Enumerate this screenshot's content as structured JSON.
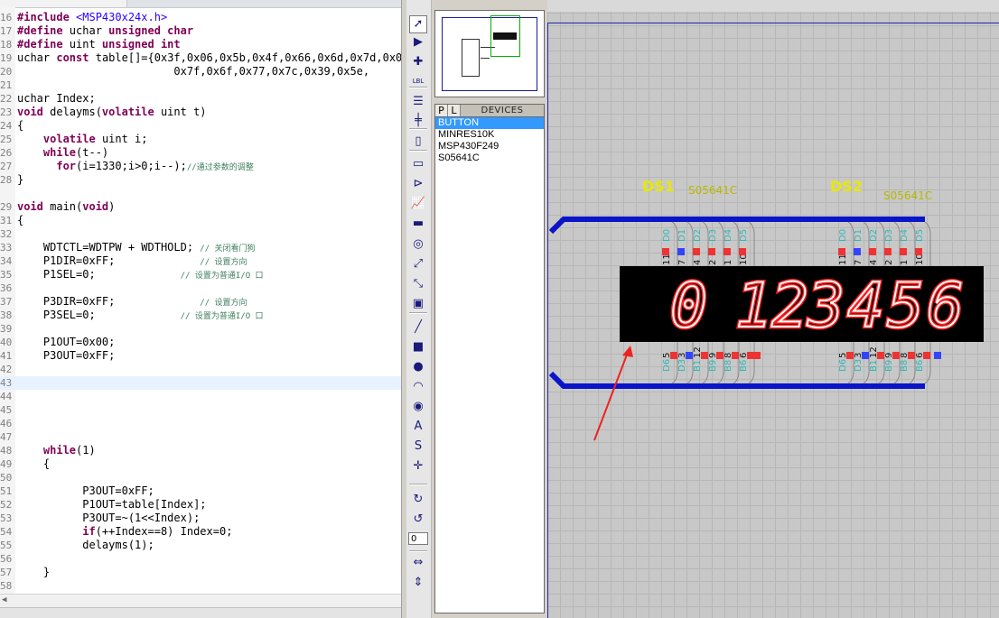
{
  "editor": {
    "lines": [
      {
        "n": "16",
        "parts": [
          [
            "pp",
            "#include "
          ],
          [
            "str",
            "<MSP430x24x.h>"
          ]
        ]
      },
      {
        "n": "17",
        "parts": [
          [
            "pp",
            "#define "
          ],
          [
            "",
            "uchar "
          ],
          [
            "kw",
            "unsigned char"
          ]
        ]
      },
      {
        "n": "18",
        "parts": [
          [
            "pp",
            "#define "
          ],
          [
            "",
            "uint "
          ],
          [
            "kw",
            "unsigned int"
          ]
        ]
      },
      {
        "n": "19",
        "parts": [
          [
            "",
            "uchar "
          ],
          [
            "kw",
            "const "
          ],
          [
            "",
            "table[]={0x3f,0x06,0x5b,0x4f,0x66,0x6d,0x7d,0x07,"
          ]
        ]
      },
      {
        "n": "20",
        "parts": [
          [
            "",
            "                        0x7f,0x6f,0x77,0x7c,0x39,0x5e,"
          ]
        ]
      },
      {
        "n": "21",
        "parts": []
      },
      {
        "n": "22",
        "parts": [
          [
            "",
            "uchar Index;"
          ]
        ]
      },
      {
        "n": "23",
        "parts": [
          [
            "kw",
            "void "
          ],
          [
            "",
            "delayms("
          ],
          [
            "kw",
            "volatile "
          ],
          [
            "",
            "uint t)"
          ]
        ]
      },
      {
        "n": "24",
        "parts": [
          [
            "",
            "{"
          ]
        ]
      },
      {
        "n": "25",
        "parts": [
          [
            "",
            "    "
          ],
          [
            "kw",
            "volatile "
          ],
          [
            "",
            "uint i;"
          ]
        ]
      },
      {
        "n": "26",
        "parts": [
          [
            "",
            "    "
          ],
          [
            "kw",
            "while"
          ],
          [
            "",
            "(t--)"
          ]
        ]
      },
      {
        "n": "27",
        "parts": [
          [
            "",
            "      "
          ],
          [
            "kw",
            "for"
          ],
          [
            "",
            "(i=1330;i>0;i--);"
          ],
          [
            "cm",
            "//通过参数的调整"
          ]
        ]
      },
      {
        "n": "28",
        "parts": [
          [
            "",
            "}"
          ]
        ]
      },
      {
        "n": "29",
        "parts": [
          [
            "kw",
            "void "
          ],
          [
            "",
            "main("
          ],
          [
            "kw",
            "void"
          ],
          [
            "",
            ")"
          ]
        ]
      },
      {
        "n": "31",
        "parts": [
          [
            "",
            "{"
          ]
        ]
      },
      {
        "n": "32",
        "parts": []
      },
      {
        "n": "33",
        "parts": [
          [
            "",
            "    WDTCTL=WDTPW + WDTHOLD; "
          ],
          [
            "cm",
            "// 关闭看门狗"
          ]
        ]
      },
      {
        "n": "34",
        "parts": [
          [
            "",
            "    P1DIR=0xFF;             "
          ],
          [
            "cm",
            "// 设置方向"
          ]
        ]
      },
      {
        "n": "35",
        "parts": [
          [
            "",
            "    P1SEL=0;             "
          ],
          [
            "cm",
            "// 设置为普通I/O 口"
          ]
        ]
      },
      {
        "n": "36",
        "parts": []
      },
      {
        "n": "37",
        "parts": [
          [
            "",
            "    P3DIR=0xFF;             "
          ],
          [
            "cm",
            "// 设置方向"
          ]
        ]
      },
      {
        "n": "38",
        "parts": [
          [
            "",
            "    P3SEL=0;             "
          ],
          [
            "cm",
            "// 设置为普通I/O 口"
          ]
        ]
      },
      {
        "n": "39",
        "parts": []
      },
      {
        "n": "40",
        "parts": [
          [
            "",
            "    P1OUT=0x00;"
          ]
        ]
      },
      {
        "n": "41",
        "parts": [
          [
            "",
            "    P3OUT=0xFF;"
          ]
        ]
      },
      {
        "n": "42",
        "parts": []
      },
      {
        "n": "43",
        "parts": [],
        "current": true
      },
      {
        "n": "44",
        "parts": []
      },
      {
        "n": "45",
        "parts": []
      },
      {
        "n": "46",
        "parts": []
      },
      {
        "n": "47",
        "parts": []
      },
      {
        "n": "48",
        "parts": [
          [
            "",
            "    "
          ],
          [
            "kw",
            "while"
          ],
          [
            "",
            "(1)"
          ]
        ]
      },
      {
        "n": "49",
        "parts": [
          [
            "",
            "    {"
          ]
        ]
      },
      {
        "n": "50",
        "parts": []
      },
      {
        "n": "51",
        "parts": [
          [
            "",
            "          P3OUT=0xFF;"
          ]
        ]
      },
      {
        "n": "52",
        "parts": [
          [
            "",
            "          P1OUT=table[Index];"
          ]
        ]
      },
      {
        "n": "53",
        "parts": [
          [
            "",
            "          P3OUT=~(1<<Index);"
          ]
        ]
      },
      {
        "n": "54",
        "parts": [
          [
            "",
            "          "
          ],
          [
            "kw",
            "if"
          ],
          [
            "",
            "(++Index==8) Index=0;"
          ]
        ]
      },
      {
        "n": "55",
        "parts": [
          [
            "",
            "          delayms(1);"
          ]
        ]
      },
      {
        "n": "56",
        "parts": []
      },
      {
        "n": "57",
        "parts": [
          [
            "",
            "    }"
          ]
        ]
      },
      {
        "n": "58",
        "parts": []
      }
    ]
  },
  "toolbar": {
    "rotation_value": "0",
    "tools": [
      {
        "name": "selection-mode-icon",
        "glyph": "➚",
        "selected": true
      },
      {
        "name": "component-mode-icon",
        "glyph": "▶"
      },
      {
        "name": "junction-dot-icon",
        "glyph": "✚"
      },
      {
        "name": "wire-label-icon",
        "glyph": "LBL"
      },
      {
        "name": "text-script-icon",
        "glyph": "☰"
      },
      {
        "name": "buses-icon",
        "glyph": "╪"
      },
      {
        "name": "subcircuit-icon",
        "glyph": "▯"
      },
      {
        "name": "terminals-icon",
        "glyph": "▭"
      },
      {
        "name": "device-pins-icon",
        "glyph": "⊳"
      },
      {
        "name": "graph-icon",
        "glyph": "📈"
      },
      {
        "name": "tape-recorder-icon",
        "glyph": "▬"
      },
      {
        "name": "generator-icon",
        "glyph": "◎"
      },
      {
        "name": "voltage-probe-icon",
        "glyph": "⤢"
      },
      {
        "name": "current-probe-icon",
        "glyph": "⤡"
      },
      {
        "name": "virtual-instruments-icon",
        "glyph": "▣"
      },
      {
        "name": "line-2d-icon",
        "glyph": "╱"
      },
      {
        "name": "box-2d-icon",
        "glyph": "■"
      },
      {
        "name": "circle-2d-icon",
        "glyph": "●"
      },
      {
        "name": "arc-2d-icon",
        "glyph": "◠"
      },
      {
        "name": "path-2d-icon",
        "glyph": "◉"
      },
      {
        "name": "text-2d-icon",
        "glyph": "A"
      },
      {
        "name": "symbol-2d-icon",
        "glyph": "S"
      },
      {
        "name": "marker-2d-icon",
        "glyph": "✛"
      },
      {
        "name": "rotate-clockwise-icon",
        "glyph": "↻"
      },
      {
        "name": "rotate-anticlockwise-icon",
        "glyph": "↺"
      },
      {
        "name": "mirror-horizontal-icon",
        "glyph": "⇔"
      },
      {
        "name": "mirror-vertical-icon",
        "glyph": "⇕"
      }
    ]
  },
  "devices": {
    "tab_p": "P",
    "tab_l": "L",
    "header": "DEVICES",
    "items": [
      {
        "label": "BUTTON",
        "selected": true
      },
      {
        "label": "MINRES10K"
      },
      {
        "label": "MSP430F249"
      },
      {
        "label": "S05641C"
      }
    ]
  },
  "schematic": {
    "displays": [
      {
        "ref": "DS1",
        "part": "S05641C",
        "digits": [
          "0",
          "",
          ""
        ]
      },
      {
        "ref": "DS2",
        "part": "S05641C",
        "digits": [
          "3",
          "4",
          "5",
          "6"
        ]
      }
    ],
    "digits_text": "0 123456",
    "top_pins": [
      {
        "label": "D0",
        "num": "11"
      },
      {
        "label": "D1",
        "num": "7"
      },
      {
        "label": "D2",
        "num": "4"
      },
      {
        "label": "D3",
        "num": "2"
      },
      {
        "label": "D4",
        "num": "1"
      },
      {
        "label": "D5",
        "num": "10"
      }
    ],
    "bottom_pins": [
      {
        "label": "D6",
        "num": "5"
      },
      {
        "label": "D3",
        "num": "3"
      },
      {
        "label": "B1",
        "num": "12"
      },
      {
        "label": "B9",
        "num": "9"
      },
      {
        "label": "B8",
        "num": "8"
      },
      {
        "label": "B6",
        "num": "6"
      }
    ],
    "colors": {
      "label": "#e8e800",
      "part": "#b8b800",
      "bus": "#0a14c8",
      "pin_high": "#ff3333",
      "pin_low": "#3344ff",
      "segment": "#ffffff",
      "segment_glow": "#ff2020",
      "arrow": "#ee2222"
    }
  }
}
